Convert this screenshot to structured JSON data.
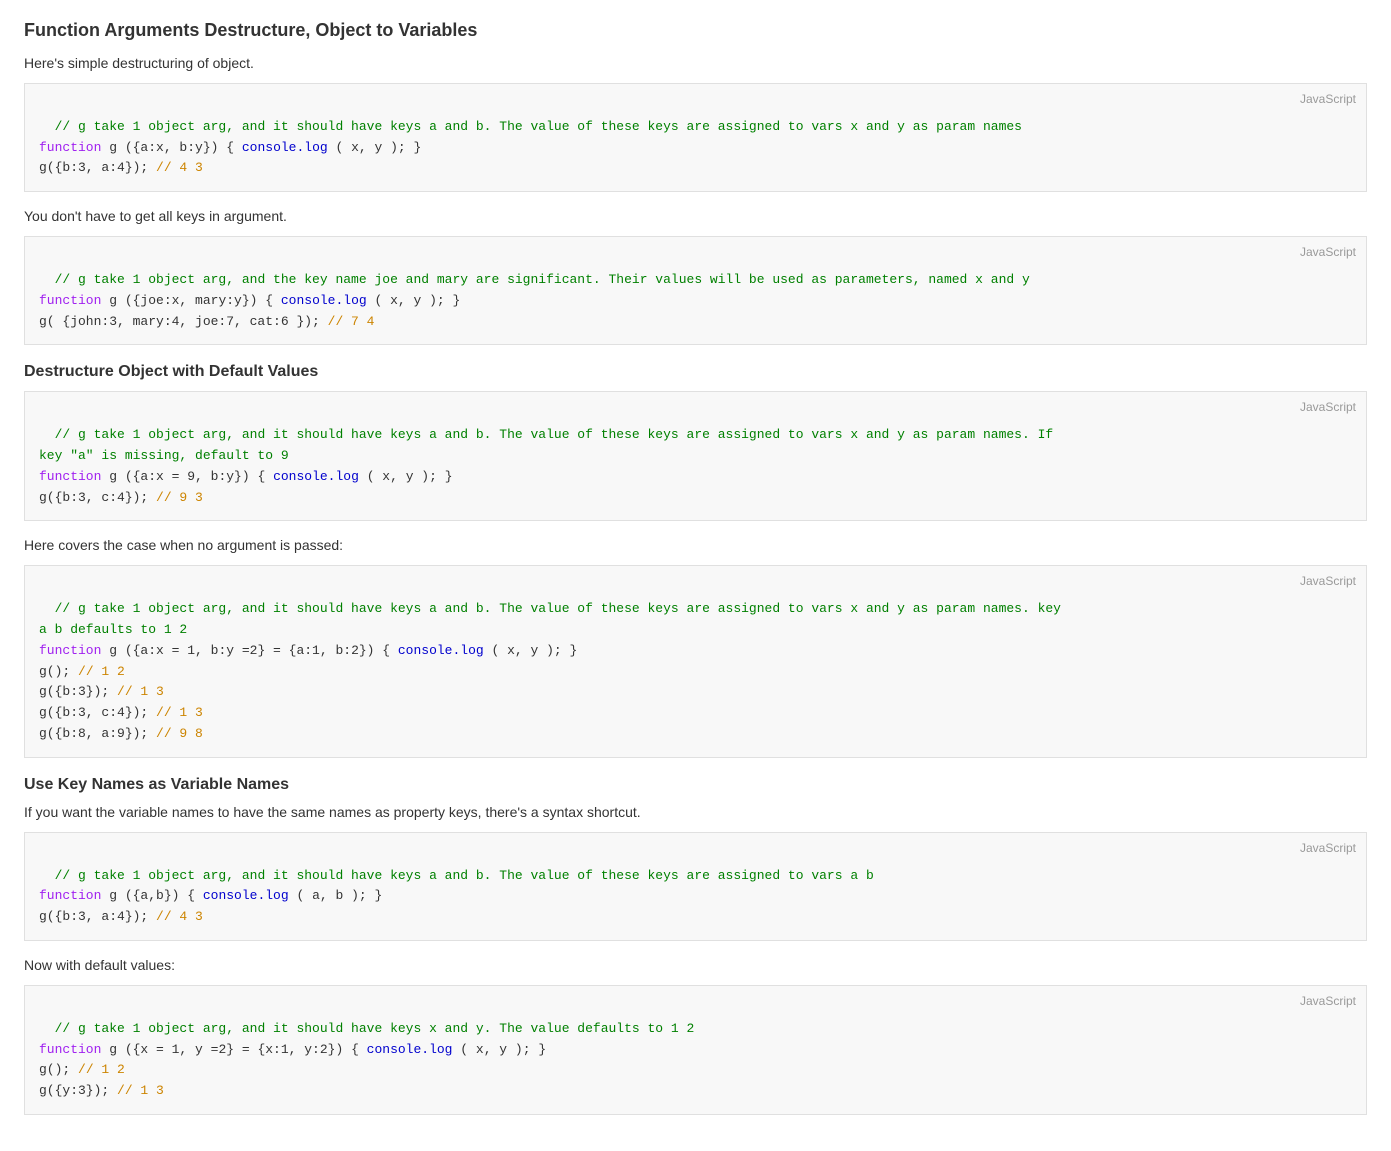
{
  "page": {
    "title": "Function Arguments Destructure, Object to Variables",
    "sections": [
      {
        "id": "section-intro",
        "description": "Here's simple destructuring of object.",
        "codeBlocks": [
          {
            "id": "code1",
            "label": "JavaScript",
            "lines": [
              {
                "type": "comment",
                "text": "// g take 1 object arg, and it should have keys a and b. The value of these keys are assigned to vars x and y as param names"
              },
              {
                "type": "mixed1",
                "keyword": "function",
                "rest": " g ({a:x, b:y}) { ",
                "console": "console.log",
                "args": " ( x, y ); }"
              },
              {
                "type": "result",
                "text": "g({b:3, a:4}); ",
                "comment": "// 4 3"
              }
            ]
          }
        ]
      },
      {
        "id": "section-not-all-keys",
        "description": "You don't have to get all keys in argument.",
        "codeBlocks": [
          {
            "id": "code2",
            "label": "JavaScript",
            "lines": [
              {
                "type": "comment",
                "text": "// g take 1 object arg, and the key name joe and mary are significant. Their values will be used as parameters, named x and y"
              },
              {
                "type": "mixed1",
                "keyword": "function",
                "rest": " g ({joe:x, mary:y}) { ",
                "console": "console.log",
                "args": " ( x, y ); }"
              },
              {
                "type": "result",
                "text": "g( {john:3, mary:4, joe:7, cat:6 }); ",
                "comment": "// 7 4"
              }
            ]
          }
        ]
      },
      {
        "id": "section-default",
        "heading": "Destructure Object with Default Values",
        "codeBlocks": [
          {
            "id": "code3",
            "label": "JavaScript",
            "lines": [
              {
                "type": "comment",
                "text": "// g take 1 object arg, and it should have keys a and b. The value of these keys are assigned to vars x and y as param names. If"
              },
              {
                "type": "comment2",
                "text": "key \"a\" is missing, default to 9"
              },
              {
                "type": "mixed1",
                "keyword": "function",
                "rest": " g ({a:x = 9, b:y}) { ",
                "console": "console.log",
                "args": " ( x, y ); }"
              },
              {
                "type": "result",
                "text": "g({b:3, c:4}); ",
                "comment": "// 9 3"
              }
            ]
          }
        ]
      },
      {
        "id": "section-no-arg",
        "description": "Here covers the case when no argument is passed:",
        "codeBlocks": [
          {
            "id": "code4",
            "label": "JavaScript",
            "lines": [
              {
                "type": "comment",
                "text": "// g take 1 object arg, and it should have keys a and b. The value of these keys are assigned to vars x and y as param names. key"
              },
              {
                "type": "comment2",
                "text": "a b defaults to 1 2"
              },
              {
                "type": "mixed2",
                "keyword": "function",
                "rest": " g ({a:x = 1, b:y =2} = {a:1, b:2}) { ",
                "console": "console.log",
                "args": " ( x, y ); }"
              },
              {
                "type": "result",
                "text": "g(); ",
                "comment": "// 1 2"
              },
              {
                "type": "result",
                "text": "g({b:3}); ",
                "comment": "// 1 3"
              },
              {
                "type": "result",
                "text": "g({b:3, c:4}); ",
                "comment": "// 1 3"
              },
              {
                "type": "result",
                "text": "g({b:8, a:9}); ",
                "comment": "// 9 8"
              }
            ]
          }
        ]
      },
      {
        "id": "section-key-names",
        "heading": "Use Key Names as Variable Names",
        "description": "If you want the variable names to have the same names as property keys, there's a syntax shortcut.",
        "codeBlocks": [
          {
            "id": "code5",
            "label": "JavaScript",
            "lines": [
              {
                "type": "comment",
                "text": "// g take 1 object arg, and it should have keys a and b. The value of these keys are assigned to vars a b"
              },
              {
                "type": "mixed3",
                "keyword": "function",
                "rest": " g ({a,b}) { ",
                "console": "console.log",
                "args": " ( a, b ); }"
              },
              {
                "type": "result",
                "text": "g({b:3, a:4}); ",
                "comment": "// 4 3"
              }
            ]
          }
        ]
      },
      {
        "id": "section-default2",
        "description": "Now with default values:",
        "codeBlocks": [
          {
            "id": "code6",
            "label": "JavaScript",
            "lines": [
              {
                "type": "comment",
                "text": "// g take 1 object arg, and it should have keys x and y. The value defaults to 1 2"
              },
              {
                "type": "mixed4",
                "keyword": "function",
                "rest": " g ({x = 1, y =2} = {x:1, y:2}) { ",
                "console": "console.log",
                "args": " ( x, y ); }"
              },
              {
                "type": "result",
                "text": "g(); ",
                "comment": "// 1 2"
              },
              {
                "type": "result",
                "text": "g({y:3}); ",
                "comment": "// 1 3"
              }
            ]
          }
        ]
      }
    ]
  }
}
